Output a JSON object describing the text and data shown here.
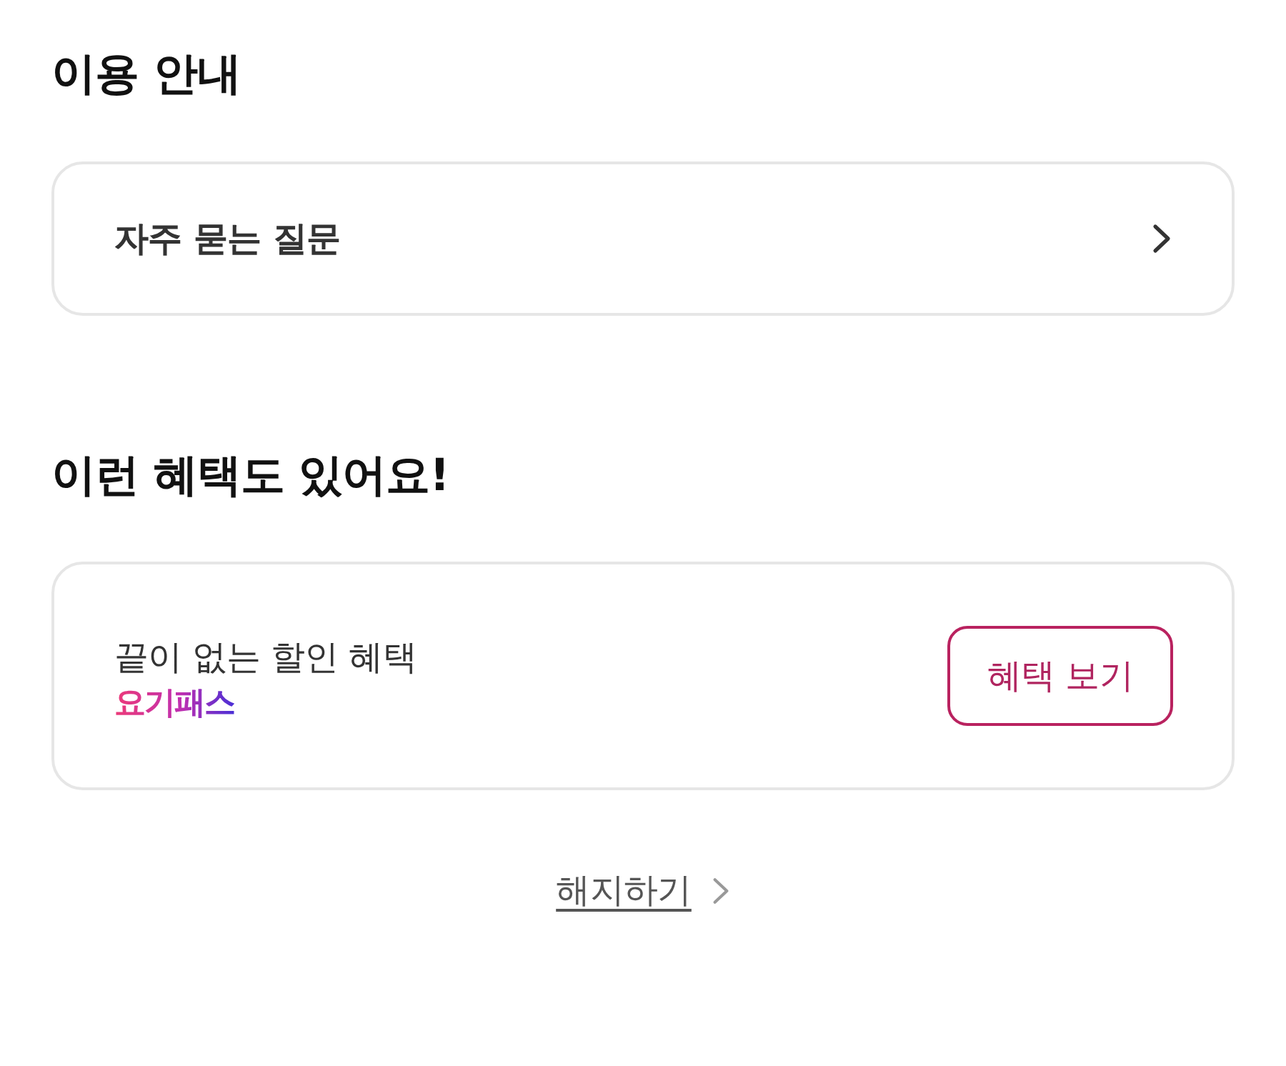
{
  "guide": {
    "title": "이용 안내",
    "faq_link": {
      "label": "자주 묻는 질문"
    }
  },
  "benefits": {
    "title": "이런 혜택도 있어요!",
    "card": {
      "description": "끝이 없는 할인 혜택",
      "brand": "요기패스",
      "button": "혜택 보기"
    }
  },
  "cancel_link": {
    "label": "해지하기"
  }
}
